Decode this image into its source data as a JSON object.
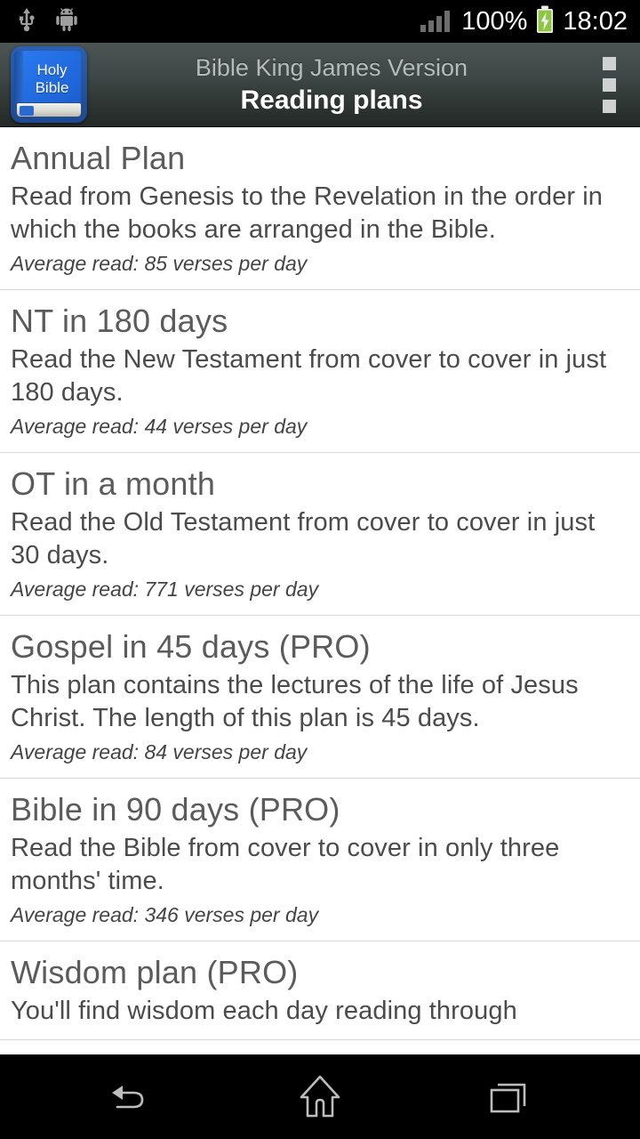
{
  "status_bar": {
    "usb_icon": "usb-icon",
    "android_icon": "android-robot-icon",
    "signal_icon": "signal-bars-icon",
    "battery_percent": "100%",
    "battery_icon": "battery-charging-icon",
    "time": "18:02"
  },
  "header": {
    "app_icon_line1": "Holy",
    "app_icon_line2": "Bible",
    "subtitle": "Bible King James Version",
    "title": "Reading plans",
    "overflow_label": "overflow-menu"
  },
  "plans": [
    {
      "title": "Annual Plan",
      "description": "Read from Genesis to the Revelation in the order in which the books are arranged in the Bible.",
      "average": "Average read: 85 verses per day"
    },
    {
      "title": "NT in 180 days",
      "description": "Read the New Testament from cover to cover in just 180 days.",
      "average": "Average read: 44 verses per day"
    },
    {
      "title": "OT in a month",
      "description": "Read the Old Testament from cover to cover in just 30 days.",
      "average": "Average read: 771 verses per day"
    },
    {
      "title": "Gospel in 45 days (PRO)",
      "description": "This plan contains the lectures of the life of Jesus Christ. The length of this plan is 45 days.",
      "average": "Average read: 84 verses per day"
    },
    {
      "title": "Bible in 90 days (PRO)",
      "description": "Read the Bible from cover to cover in only three months' time.",
      "average": "Average read: 346 verses per day"
    },
    {
      "title": "Wisdom plan (PRO)",
      "description": "You'll find wisdom each day reading through",
      "average": ""
    }
  ],
  "nav_bar": {
    "back": "back-icon",
    "home": "home-icon",
    "recents": "recent-apps-icon"
  },
  "colors": {
    "status_bar_bg": "#000000",
    "header_gradient_top": "#4c5553",
    "header_gradient_bottom": "#232927",
    "list_bg": "#ffffff",
    "divider": "#d6d6d6",
    "title_text": "#5b5b5b",
    "body_text": "#4b4b4b",
    "battery_green": "#8ec63f",
    "nav_icon": "#bdbdbd",
    "app_icon_blue": "#2a6ad0"
  }
}
